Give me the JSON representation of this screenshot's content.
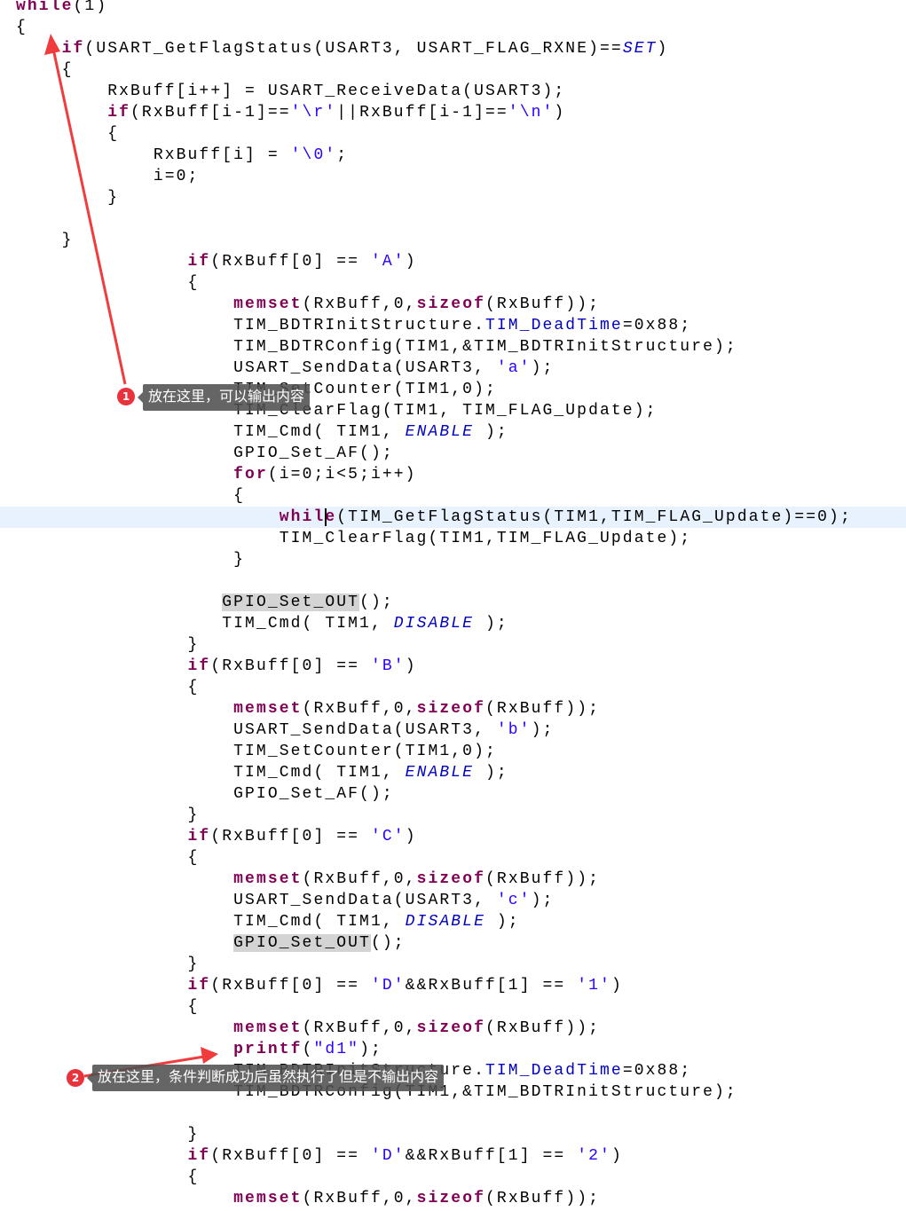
{
  "editor": {
    "highlighted_line": 24,
    "lines": [
      "while(1)",
      "{",
      "    if(USART_GetFlagStatus(USART3, USART_FLAG_RXNE)==SET)",
      "    {",
      "        RxBuff[i++] = USART_ReceiveData(USART3);",
      "        if(RxBuff[i-1]=='\\r'||RxBuff[i-1]=='\\n')",
      "        {",
      "            RxBuff[i] = '\\0';",
      "            i=0;",
      "        }",
      "",
      "    }",
      "               if(RxBuff[0] == 'A')",
      "               {",
      "                   memset(RxBuff,0,sizeof(RxBuff));",
      "                   TIM_BDTRInitStructure.TIM_DeadTime=0x88;",
      "                   TIM_BDTRConfig(TIM1,&TIM_BDTRInitStructure);",
      "                   USART_SendData(USART3, 'a');",
      "                   TIM_SetCounter(TIM1,0);",
      "                   TIM_ClearFlag(TIM1, TIM_FLAG_Update);",
      "                   TIM_Cmd( TIM1, ENABLE );",
      "                   GPIO_Set_AF();",
      "                   for(i=0;i<5;i++)",
      "                   {",
      "                       while(TIM_GetFlagStatus(TIM1,TIM_FLAG_Update)==0);",
      "                       TIM_ClearFlag(TIM1,TIM_FLAG_Update);",
      "                   }",
      "",
      "                  GPIO_Set_OUT();",
      "                  TIM_Cmd( TIM1, DISABLE );",
      "               }",
      "               if(RxBuff[0] == 'B')",
      "               {",
      "                   memset(RxBuff,0,sizeof(RxBuff));",
      "                   USART_SendData(USART3, 'b');",
      "                   TIM_SetCounter(TIM1,0);",
      "                   TIM_Cmd( TIM1, ENABLE );",
      "                   GPIO_Set_AF();",
      "               }",
      "               if(RxBuff[0] == 'C')",
      "               {",
      "                   memset(RxBuff,0,sizeof(RxBuff));",
      "                   USART_SendData(USART3, 'c');",
      "                   TIM_Cmd( TIM1, DISABLE );",
      "                   GPIO_Set_OUT();",
      "               }",
      "               if(RxBuff[0] == 'D'&&RxBuff[1] == '1')",
      "               {",
      "                   memset(RxBuff,0,sizeof(RxBuff));",
      "                   printf(\"d1\");",
      "                   TIM_BDTRInitStructure.TIM_DeadTime=0x88;",
      "                   TIM_BDTRConfig(TIM1,&TIM_BDTRInitStructure);",
      "",
      "               }",
      "               if(RxBuff[0] == 'D'&&RxBuff[1] == '2')",
      "               {",
      "                   memset(RxBuff,0,sizeof(RxBuff));"
    ],
    "marked_lines": [
      28,
      44
    ],
    "colors": {
      "keyword": "#7f0055",
      "string": "#2a00ff",
      "constant": "#0000c0",
      "current_line": "#e8f2fe",
      "annotation": "#e8323c"
    }
  },
  "annotations": [
    {
      "number": "1",
      "text": "放在这里，可以输出内容"
    },
    {
      "number": "2",
      "text": "放在这里，条件判断成功后虽然执行了但是不输出内容"
    }
  ]
}
